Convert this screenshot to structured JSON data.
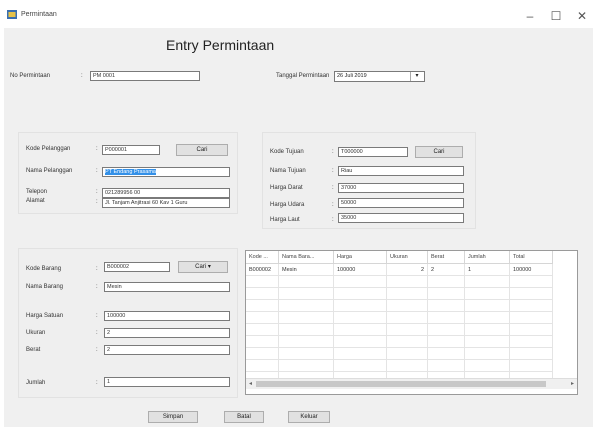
{
  "window": {
    "title": "Permintaan",
    "min": "–",
    "max": "☐",
    "close": "✕"
  },
  "heading": "Entry Permintaan",
  "header_fields": {
    "no_permintaan_label": "No Permintaan",
    "no_permintaan_value": "PM 0001",
    "tanggal_label": "Tanggal Permintaan",
    "tanggal_value": "26   Juli   2019"
  },
  "pelanggan": {
    "kode_label": "Kode Pelanggan",
    "kode_value": "P000001",
    "cari": "Cari",
    "nama_label": "Nama Pelanggan",
    "nama_value": "PT Endang Prasama",
    "telepon_label": "Telepon",
    "telepon_value": "021289956 00",
    "alamat_label": "Alamat",
    "alamat_value": "Jl. Tanjam Anjitrasi 60 Kav 1 Guru"
  },
  "tujuan": {
    "kode_label": "Kode Tujuan",
    "kode_value": "T000000",
    "cari": "Cari",
    "nama_label": "Nama Tujuan",
    "nama_value": "Riau",
    "darat_label": "Harga Darat",
    "darat_value": "37000",
    "udara_label": "Harga Udara",
    "udara_value": "50000",
    "laut_label": "Harga Laut",
    "laut_value": "35000"
  },
  "barang": {
    "kode_label": "Kode Barang",
    "kode_value": "B000002",
    "cari": "Cari",
    "nama_label": "Nama Barang",
    "nama_value": "Mesin",
    "harga_label": "Harga Satuan",
    "harga_value": "100000",
    "ukuran_label": "Ukuran",
    "ukuran_value": "2",
    "berat_label": "Berat",
    "berat_value": "2",
    "jumlah_label": "Jumlah",
    "jumlah_value": "1"
  },
  "grid": {
    "columns": [
      "Kode ...",
      "Nama Bara...",
      "Harga",
      "Ukuran",
      "Berat",
      "Jumlah",
      "Total"
    ],
    "rows": [
      [
        "B000002",
        "Mesin",
        "100000",
        "2",
        "2",
        "1",
        "100000"
      ]
    ]
  },
  "buttons": {
    "simpan": "Simpan",
    "batal": "Batal",
    "keluar": "Keluar"
  }
}
